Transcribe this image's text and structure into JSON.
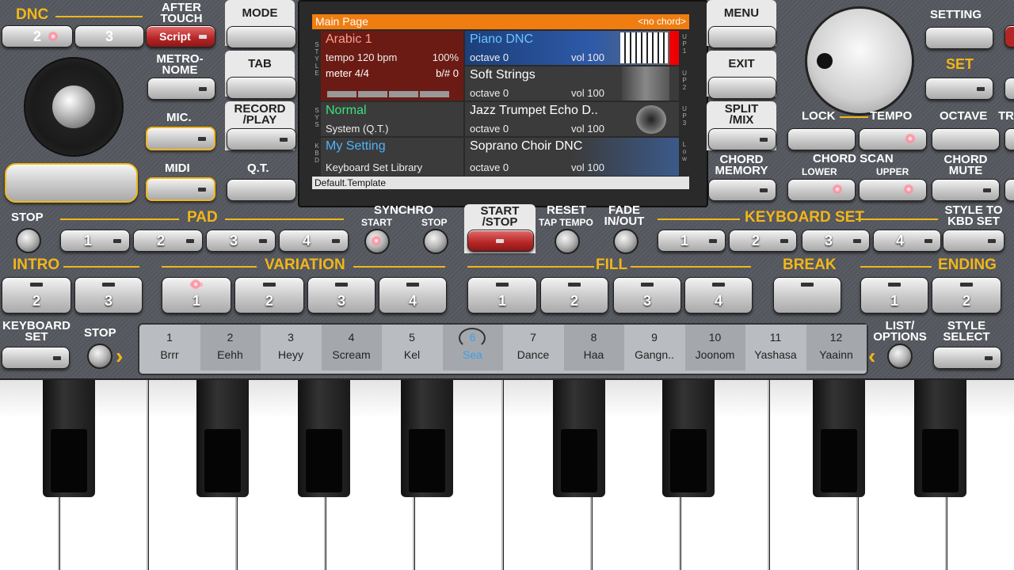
{
  "left": {
    "dnc": "DNC",
    "after_touch": "AFTER\nTOUCH",
    "dnc_btn2": "2",
    "dnc_btn3": "3",
    "script": "Script",
    "metronome": "METRO-\nNOME",
    "mic": "MIC.",
    "midi": "MIDI"
  },
  "center_tabs": {
    "mode": "MODE",
    "tab": "TAB",
    "record": "RECORD\n/PLAY",
    "qt": "Q.T."
  },
  "screen": {
    "header": "Main Page",
    "chord": "<no chord>",
    "style_name": "Arabic 1",
    "tempo": "tempo 120 bpm",
    "percent": "100%",
    "meter": "meter 4/4",
    "bsharp": "b/# 0",
    "sys_name": "Normal",
    "sys_sub": "System (Q.T.)",
    "kbd_name": "My Setting",
    "kbd_sub": "Keyboard Set Library",
    "upper1": "Piano DNC",
    "upper2": "Soft Strings",
    "upper3": "Jazz Trumpet Echo D..",
    "lower": "Soprano Choir DNC",
    "octave": "octave  0",
    "vol": "vol 100",
    "footer": "Default.Template",
    "side_style": "STYLE",
    "side_sys": "SYS",
    "side_kbd": "KBD",
    "side_up1": "UP1",
    "side_up2": "UP2",
    "side_up3": "UP3",
    "side_low": "Low"
  },
  "right_tabs": {
    "menu": "MENU",
    "exit": "EXIT",
    "split": "SPLIT\n/MIX",
    "chord_memory": "CHORD\nMEMORY"
  },
  "right": {
    "setting": "SETTING",
    "set": "SET",
    "lock": "LOCK",
    "tempo": "TEMPO",
    "octave": "OCTAVE",
    "tr": "TR",
    "chord_scan": "CHORD SCAN",
    "lower": "LOWER",
    "upper": "UPPER",
    "chord_mute": "CHORD\nMUTE"
  },
  "row2": {
    "stop": "STOP",
    "pad": "PAD",
    "pads": [
      "1",
      "2",
      "3",
      "4"
    ],
    "synchro": "SYNCHRO",
    "start": "START",
    "sync_stop": "STOP",
    "start_stop": "START\n/STOP",
    "reset": "RESET",
    "tap_tempo": "TAP TEMPO",
    "fade": "FADE\nIN/OUT",
    "keyboard_set": "KEYBOARD SET",
    "kbdset": [
      "1",
      "2",
      "3",
      "4"
    ],
    "style_to_kbd": "STYLE TO\nKBD SET"
  },
  "row3": {
    "intro": "INTRO",
    "intro_btns": [
      "2",
      "3"
    ],
    "variation": "VARIATION",
    "var_btns": [
      "1",
      "2",
      "3",
      "4"
    ],
    "fill": "FILL",
    "fill_btns": [
      "1",
      "2",
      "3",
      "4"
    ],
    "break": "BREAK",
    "ending": "ENDING",
    "end_btns": [
      "1",
      "2"
    ]
  },
  "row4": {
    "keyboard_set": "KEYBOARD\nSET",
    "stop": "STOP",
    "list_options": "LIST/\nOPTIONS",
    "style_select": "STYLE\nSELECT"
  },
  "pads": [
    {
      "n": "1",
      "name": "Brrr"
    },
    {
      "n": "2",
      "name": "Eehh"
    },
    {
      "n": "3",
      "name": "Heyy"
    },
    {
      "n": "4",
      "name": "Scream"
    },
    {
      "n": "5",
      "name": "Kel"
    },
    {
      "n": "6",
      "name": "Sea"
    },
    {
      "n": "7",
      "name": "Dance"
    },
    {
      "n": "8",
      "name": "Haa"
    },
    {
      "n": "9",
      "name": "Gangn.."
    },
    {
      "n": "10",
      "name": "Joonom"
    },
    {
      "n": "11",
      "name": "Yashasa"
    },
    {
      "n": "12",
      "name": "Yaainn"
    }
  ],
  "colors": {
    "accent": "#f2b61a",
    "screen_header": "#f07d10",
    "style_cell": "#6b1b14",
    "active_pad": "#3aa0e8"
  }
}
